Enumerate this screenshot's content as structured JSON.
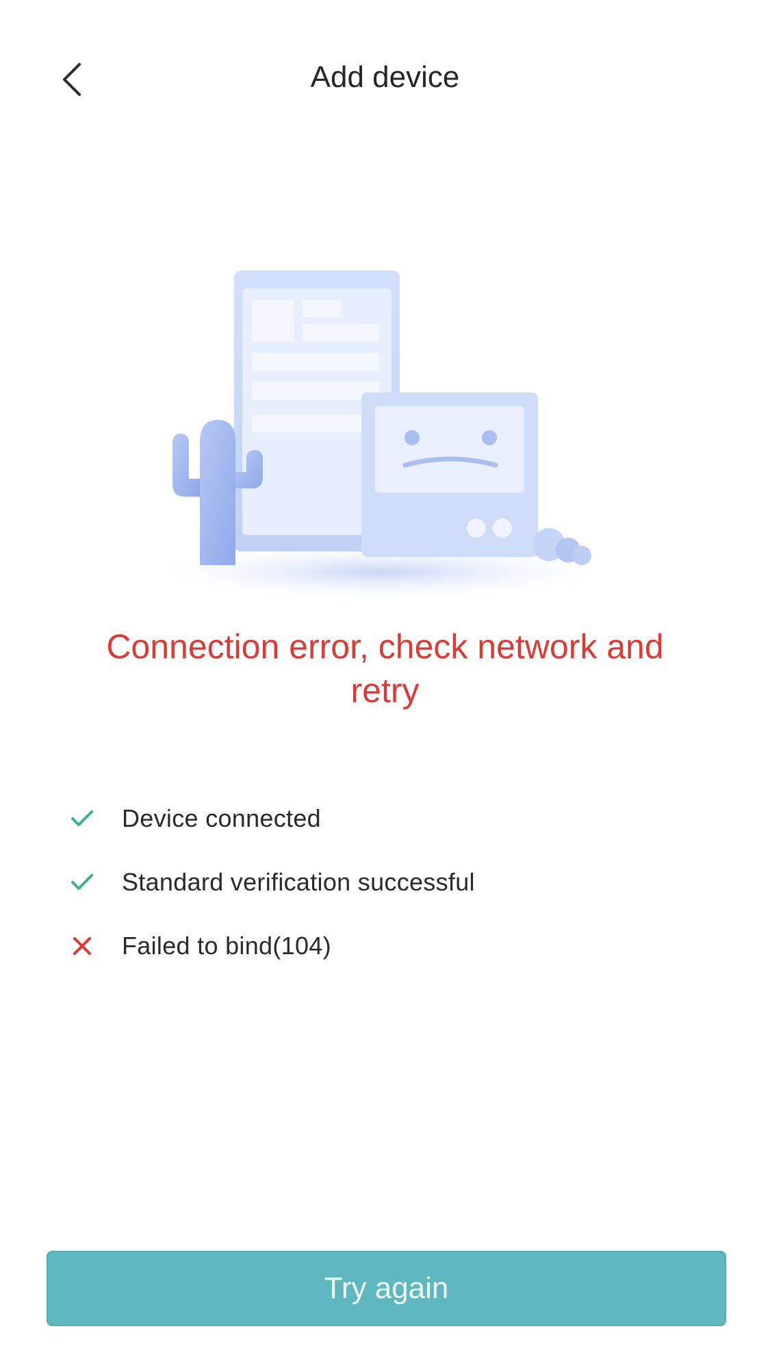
{
  "header": {
    "title": "Add device",
    "back_icon": "chevron-left-icon"
  },
  "error": {
    "message": "Connection error, check network and retry"
  },
  "steps": [
    {
      "label": "Device connected",
      "status": "success",
      "icon": "check-icon"
    },
    {
      "label": "Standard verification successful",
      "status": "success",
      "icon": "check-icon"
    },
    {
      "label": "Failed to bind(104)",
      "status": "failed",
      "icon": "cross-icon"
    }
  ],
  "actions": {
    "retry_label": "Try again"
  },
  "colors": {
    "error": "#dd3a34",
    "success": "#3fae8e",
    "button": "#5fb8bf",
    "illustration": "#c9d8f5"
  }
}
